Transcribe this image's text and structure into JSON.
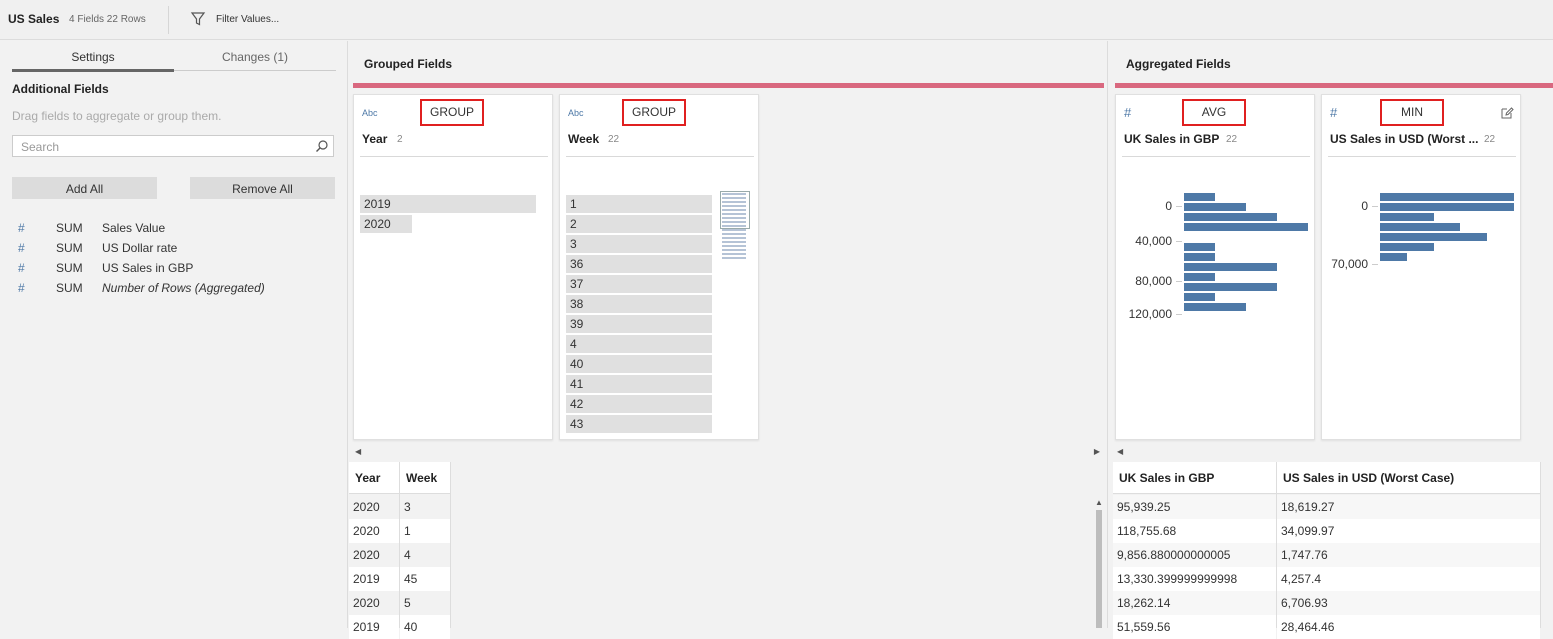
{
  "topbar": {
    "title": "US Sales",
    "meta": "4 Fields  22 Rows",
    "filter_label": "Filter Values..."
  },
  "left_panel": {
    "tabs": [
      {
        "label": "Settings",
        "active": true
      },
      {
        "label": "Changes (1)",
        "active": false
      }
    ],
    "heading": "Additional Fields",
    "hint": "Drag fields to aggregate or group them.",
    "search_placeholder": "Search",
    "add_all_label": "Add All",
    "remove_all_label": "Remove All",
    "fields": [
      {
        "icon": "#",
        "agg": "SUM",
        "name": "Sales Value"
      },
      {
        "icon": "#",
        "agg": "SUM",
        "name": "US Dollar rate"
      },
      {
        "icon": "#",
        "agg": "SUM",
        "name": "US Sales in GBP"
      },
      {
        "icon": "#",
        "agg": "SUM",
        "name": "Number of Rows (Aggregated)"
      }
    ]
  },
  "grouped": {
    "title": "Grouped Fields",
    "cards": [
      {
        "type_label": "Abc",
        "agg": "GROUP",
        "name": "Year",
        "count": "2",
        "values": [
          "2019",
          "2020"
        ]
      },
      {
        "type_label": "Abc",
        "agg": "GROUP",
        "name": "Week",
        "count": "22",
        "values": [
          "1",
          "2",
          "3",
          "36",
          "37",
          "38",
          "39",
          "4",
          "40",
          "41",
          "42",
          "43"
        ]
      }
    ]
  },
  "aggregated": {
    "title": "Aggregated Fields",
    "cards": [
      {
        "type_label": "#",
        "agg": "AVG",
        "name": "UK Sales in GBP",
        "count": "22",
        "axis_labels": [
          "0",
          "40,000",
          "80,000",
          "120,000"
        ],
        "histogram_counts": [
          1,
          2,
          3,
          4,
          0,
          1,
          1,
          3,
          1,
          3,
          1,
          2
        ]
      },
      {
        "type_label": "#",
        "agg": "MIN",
        "name": "US Sales in USD (Worst ...",
        "count": "22",
        "axis_labels": [
          "0",
          "70,000"
        ],
        "histogram_counts": [
          5,
          5,
          2,
          3,
          4,
          2,
          1
        ]
      }
    ]
  },
  "bottom_left_table": {
    "columns": [
      "Year",
      "Week"
    ],
    "rows": [
      [
        "2020",
        "3"
      ],
      [
        "2020",
        "1"
      ],
      [
        "2020",
        "4"
      ],
      [
        "2019",
        "45"
      ],
      [
        "2020",
        "5"
      ],
      [
        "2019",
        "40"
      ]
    ]
  },
  "bottom_right_table": {
    "columns": [
      "UK Sales in GBP",
      "US Sales in USD (Worst Case)"
    ],
    "rows": [
      [
        "95,939.25",
        "18,619.27"
      ],
      [
        "118,755.68",
        "34,099.97"
      ],
      [
        "9,856.880000000005",
        "1,747.76"
      ],
      [
        "13,330.399999999998",
        "4,257.4"
      ],
      [
        "18,262.14",
        "6,706.93"
      ],
      [
        "51,559.56",
        "28,464.46"
      ]
    ]
  },
  "colors": {
    "accent_bar": "#d9687f",
    "histogram": "#4e79a7",
    "highlight_box": "#e02020"
  }
}
